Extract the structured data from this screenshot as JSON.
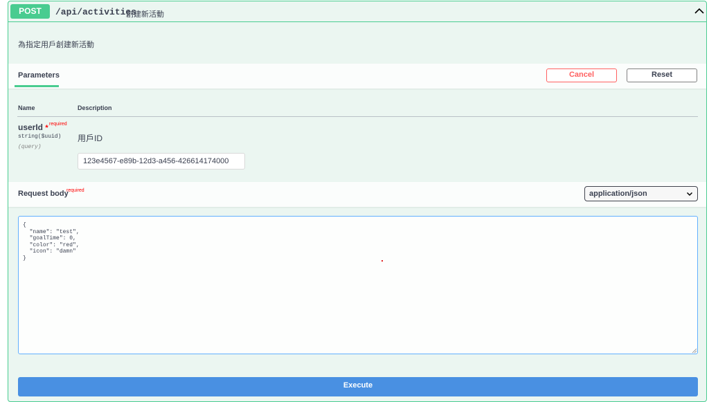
{
  "operation": {
    "method": "POST",
    "path": "/api/activities",
    "summary": "創建新活動",
    "description": "為指定用戶創建新活動"
  },
  "parameters": {
    "tab_label": "Parameters",
    "cancel_label": "Cancel",
    "reset_label": "Reset",
    "columns": {
      "name": "Name",
      "description": "Description"
    },
    "items": [
      {
        "name": "userId",
        "required_mark": "*",
        "required_label": "required",
        "type": "string($uuid)",
        "in": "(query)",
        "description": "用戶ID",
        "value": "123e4567-e89b-12d3-a456-426614174000"
      }
    ]
  },
  "request_body": {
    "title": "Request body",
    "required_label": "required",
    "content_type": "application/json",
    "value": "{\n  \"name\": \"test\",\n  \"goalTime\": 0,\n  \"color\": \"red\",\n  \"icon\": \"damn\"\n}"
  },
  "execute_label": "Execute",
  "colors": {
    "post_green": "#49cc90",
    "block_bg": "#ebf6f1",
    "cancel_red": "#ff6060",
    "execute_blue": "#4990e2"
  },
  "icons": {
    "collapse": "chevron-up-icon",
    "select": "chevron-down-icon",
    "resize": "resize-handle-icon"
  }
}
